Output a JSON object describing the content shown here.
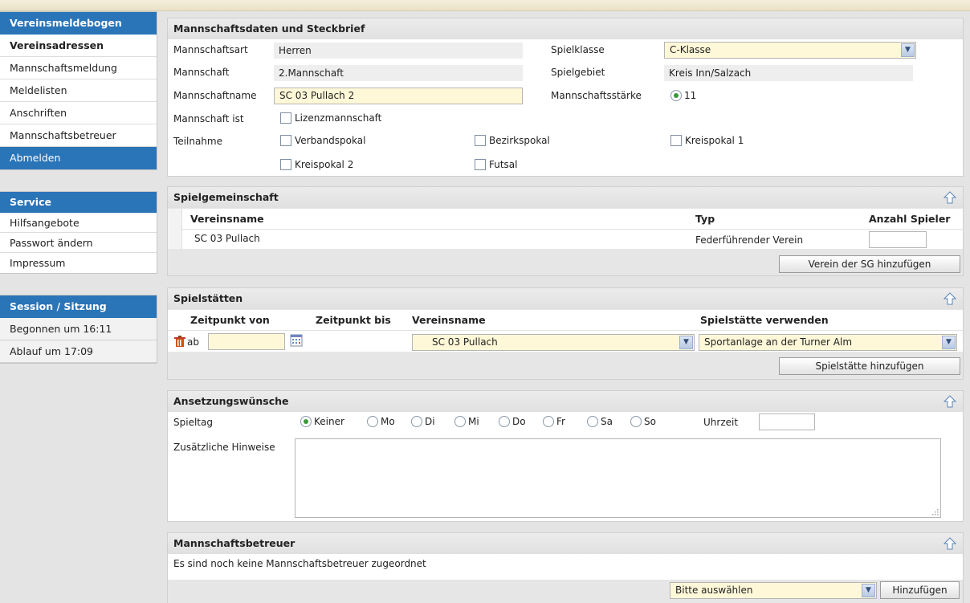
{
  "sidebar": {
    "meldebogen": {
      "title": "Vereinsmeldebogen",
      "items": [
        "Vereinsadressen",
        "Mannschaftsmeldung",
        "Meldelisten",
        "Anschriften",
        "Mannschaftsbetreuer",
        "Abmelden"
      ]
    },
    "service": {
      "title": "Service",
      "items": [
        "Hilfsangebote",
        "Passwort ändern",
        "Impressum"
      ]
    },
    "session": {
      "title": "Session / Sitzung",
      "started": "Begonnen um 16:11",
      "expires": "Ablauf um 17:09"
    }
  },
  "team": {
    "title": "Mannschaftsdaten und Steckbrief",
    "labels": {
      "art": "Mannschaftsart",
      "mannschaft": "Mannschaft",
      "name": "Mannschaftname",
      "ist": "Mannschaft ist",
      "teilnahme": "Teilnahme",
      "spielklasse": "Spielklasse",
      "spielgebiet": "Spielgebiet",
      "staerke": "Mannschaftsstärke"
    },
    "art": "Herren",
    "mannschaft": "2.Mannschaft",
    "name": "SC 03 Pullach 2",
    "spielklasse": "C-Klasse",
    "spielgebiet": "Kreis Inn/Salzach",
    "staerke": "11",
    "lizenz": "Lizenzmannschaft",
    "teilnahme": [
      "Verbandspokal",
      "Bezirkspokal",
      "Kreispokal 1",
      "Kreispokal 2",
      "Futsal"
    ]
  },
  "sg": {
    "title": "Spielgemeinschaft",
    "headers": {
      "name": "Vereinsname",
      "typ": "Typ",
      "anzahl": "Anzahl Spieler"
    },
    "row": {
      "name": "SC 03 Pullach",
      "typ": "Federführender Verein"
    },
    "add_button": "Verein der SG hinzufügen"
  },
  "staetten": {
    "title": "Spielstätten",
    "headers": {
      "von": "Zeitpunkt von",
      "bis": "Zeitpunkt bis",
      "verein": "Vereinsname",
      "verwenden": "Spielstätte verwenden"
    },
    "row": {
      "ab": "ab",
      "verein": "SC 03 Pullach",
      "staette": "Sportanlage an der Turner Alm"
    },
    "add_button": "Spielstätte hinzufügen"
  },
  "ansetzung": {
    "title": "Ansetzungswünsche",
    "spieltag_label": "Spieltag",
    "days": [
      "Keiner",
      "Mo",
      "Di",
      "Mi",
      "Do",
      "Fr",
      "Sa",
      "So"
    ],
    "selected_day": "Keiner",
    "uhrzeit_label": "Uhrzeit",
    "hinweise_label": "Zusätzliche Hinweise"
  },
  "betreuer": {
    "title": "Mannschaftsbetreuer",
    "message": "Es sind noch keine Mannschaftsbetreuer zugeordnet",
    "select_value": "Bitte auswählen",
    "add_button": "Hinzufügen"
  },
  "colors": {
    "accent": "#2a74b8",
    "input_bg": "#fff8d8"
  }
}
